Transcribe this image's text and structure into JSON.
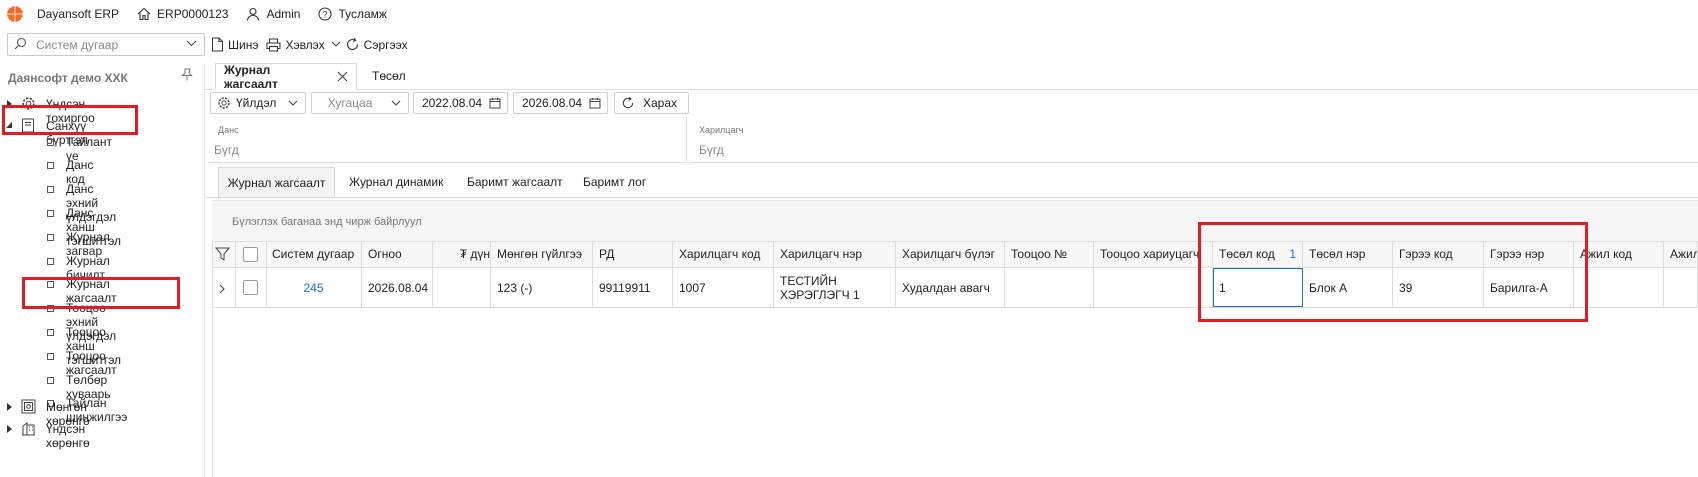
{
  "app": {
    "logo_icon": "dayansoft-logo-icon",
    "name": "Dayansoft ERP",
    "db_code": "ERP0000123",
    "user": "Admin",
    "help": "Тусламж"
  },
  "toolbar": {
    "search_placeholder": "Систем дугаар",
    "new_label": "Шинэ",
    "print_label": "Хэвлэх",
    "refresh_label": "Сэргээх"
  },
  "sidebar": {
    "company": "Даянсофт демо ХХК",
    "groups": [
      {
        "label": "Үндсэн тохиргоо",
        "icon": "gear-icon"
      },
      {
        "label": "Санхүү бүртгэл",
        "icon": "ledger-icon"
      },
      {
        "label": "Мөнгөн хөрөнгө",
        "icon": "cash-icon"
      },
      {
        "label": "Үндсэн хөрөнгө",
        "icon": "building-icon"
      }
    ],
    "items": [
      {
        "label": "Тайлант үе"
      },
      {
        "label": "Данс код"
      },
      {
        "label": "Данс эхний үлдэгдэл"
      },
      {
        "label": "Данс ханш тэгшитгэл"
      },
      {
        "label": "Журнал загвар"
      },
      {
        "label": "Журнал бичилт"
      },
      {
        "label": "Журнал жагсаалт"
      },
      {
        "label": "Тооцоо эхний үлдэгдэл"
      },
      {
        "label": "Тооцоо ханш тэгшитгэл"
      },
      {
        "label": "Тооцоо жагсаалт"
      },
      {
        "label": "Төлбөр хуваарь"
      },
      {
        "label": "Тайлан шинжилгээ"
      }
    ]
  },
  "doc_tabs": [
    {
      "label": "Журнал жагсаалт",
      "active": true
    },
    {
      "label": "Төсөл",
      "active": false
    }
  ],
  "filters": {
    "operation_label": "Үйлдэл",
    "period_placeholder": "Хугацаа",
    "date_from": "2022.08.04",
    "date_to": "2026.08.04",
    "view_label": "Харах",
    "account_label": "Данс",
    "account_value": "Бүгд",
    "partner_label": "Харилцагч",
    "partner_value": "Бүгд"
  },
  "sub_tabs": [
    {
      "label": "Журнал жагсаалт",
      "active": true
    },
    {
      "label": "Журнал динамик",
      "active": false
    },
    {
      "label": "Баримт жагсаалт",
      "active": false
    },
    {
      "label": "Баримт лог",
      "active": false
    }
  ],
  "group_hint": "Бүлэглэх баганаа энд чирж байрлуул",
  "grid": {
    "columns": [
      "Систем дугаар",
      "Огноо",
      "дүн ₮",
      "Мөнгөн гүйлгээ",
      "РД",
      "Харилцагч код",
      "Харилцагч нэр",
      "Харилцагч бүлэг",
      "Тооцоо №",
      "Тооцоо хариуцагч",
      "Төсөл код",
      "Төсөл нэр",
      "Гэрээ код",
      "Гэрээ нэр",
      "Ажил код",
      "Ажил"
    ],
    "sort_index": "1",
    "rows": [
      {
        "cells": [
          "245",
          "2026.08.04",
          "",
          "123 (-)",
          "99119911",
          "1007",
          "ТЕСТИЙН ХЭРЭГЛЭГЧ 1",
          "Худалдан авагч",
          "",
          "",
          "1",
          "Блок А",
          "39",
          "Барилга-А",
          "",
          ""
        ]
      }
    ]
  },
  "colors": {
    "highlight": "#e31b23",
    "link": "#1a6fc0",
    "logo": "#f26b2a"
  }
}
